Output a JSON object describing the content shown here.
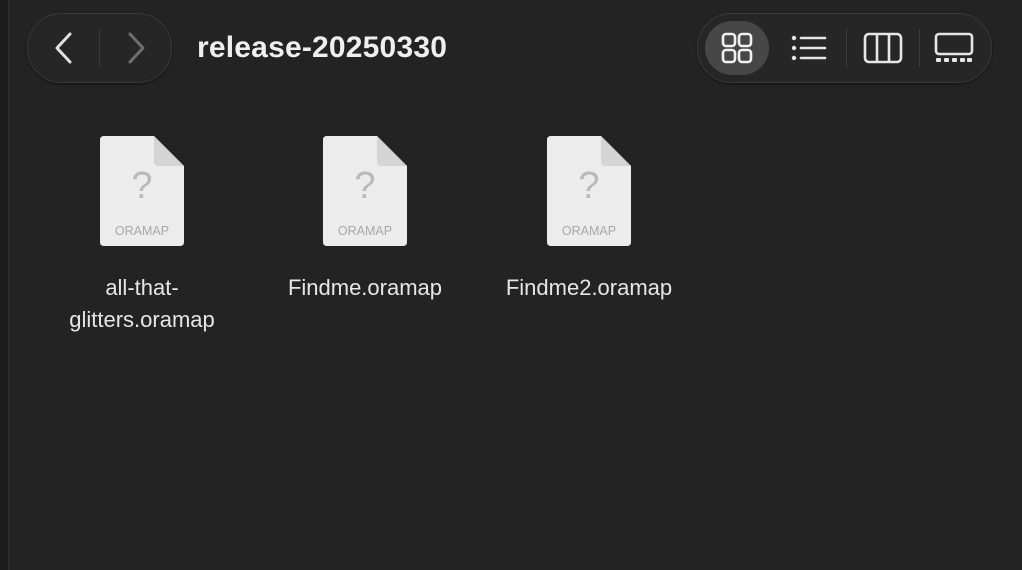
{
  "window": {
    "title": "release-20250330"
  },
  "navigation": {
    "back_icon": "chevron-left-icon",
    "forward_icon": "chevron-right-icon"
  },
  "view_modes": [
    {
      "name": "icon-view",
      "icon": "grid-icon",
      "active": true
    },
    {
      "name": "list-view",
      "icon": "list-icon",
      "active": false
    },
    {
      "name": "column-view",
      "icon": "columns-icon",
      "active": false
    },
    {
      "name": "gallery-view",
      "icon": "gallery-icon",
      "active": false
    }
  ],
  "files": [
    {
      "name_line1": "all-that-",
      "name_line2": "glitters.oramap",
      "icon_glyph": "?",
      "icon_ext": "ORAMAP"
    },
    {
      "name_line1": "Findme.oramap",
      "name_line2": "",
      "icon_glyph": "?",
      "icon_ext": "ORAMAP"
    },
    {
      "name_line1": "Findme2.oramap",
      "name_line2": "",
      "icon_glyph": "?",
      "icon_ext": "ORAMAP"
    }
  ],
  "colors": {
    "background": "#232323",
    "pill": "#262626",
    "active_view": "#474747",
    "text": "#e8e8e8"
  }
}
